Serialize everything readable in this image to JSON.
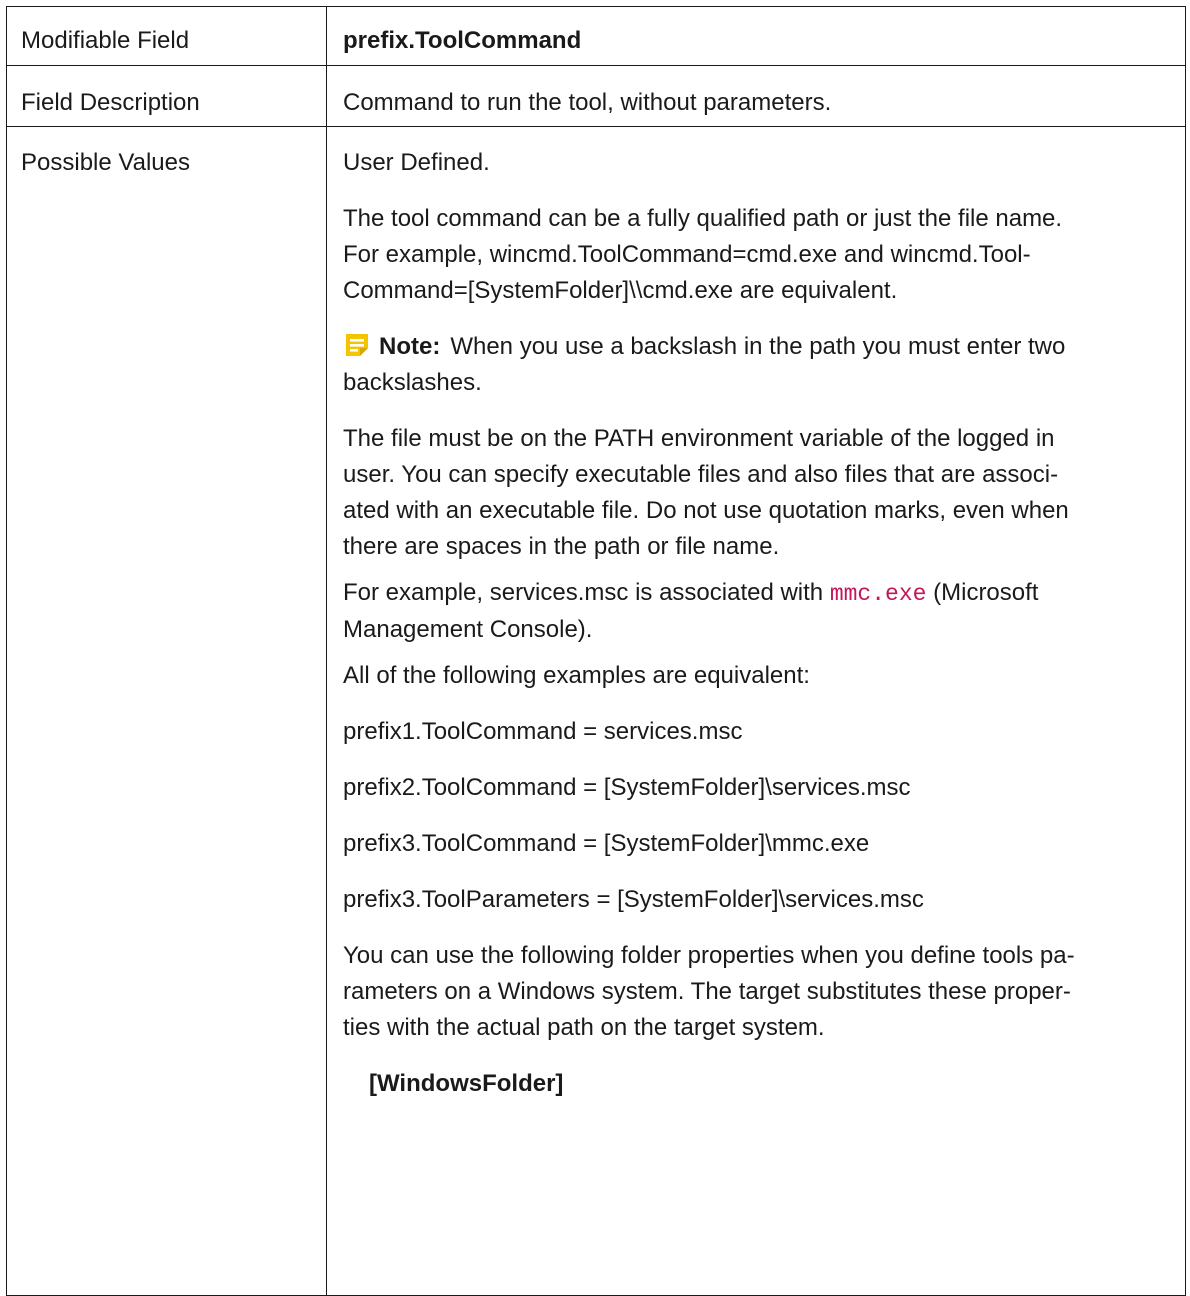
{
  "table": {
    "rows": {
      "modifiable_field": {
        "label": "Modifiable Field",
        "value": "prefix.ToolCommand"
      },
      "field_description": {
        "label": "Field Description",
        "value": "Command to run the tool, without parameters."
      },
      "possible_values": {
        "label": "Possible Values",
        "p1": "User Defined.",
        "p2_line1": "The tool command can be a fully qualified path or just the file name.",
        "p2_line2": "For example, wincmd.ToolCommand=cmd.exe and wincmd.Tool-",
        "p2_line3": "Command=[SystemFolder]\\\\cmd.exe are equivalent.",
        "note_label": "Note:",
        "note_text_line1": "When you use a backslash in the path you must enter two",
        "note_text_line2": "backslashes.",
        "p3_line1": "The file must be on the PATH environment variable of the logged in",
        "p3_line2": "user. You can specify executable files and also files that are associ-",
        "p3_line3": "ated with an executable file. Do not use quotation marks, even when",
        "p3_line4": "there are spaces in the path or file name.",
        "p4_before": "For example, services.msc is associated with ",
        "p4_code": "mmc.exe",
        "p4_after": " (Microsoft",
        "p4_line2": "Management Console).",
        "p5": "All of the following examples are equivalent:",
        "example1": "prefix1.ToolCommand = services.msc",
        "example2": "prefix2.ToolCommand = [SystemFolder]\\services.msc",
        "example3": "prefix3.ToolCommand = [SystemFolder]\\mmc.exe",
        "example4": "prefix3.ToolParameters = [SystemFolder]\\services.msc",
        "p6_line1": "You can use the following folder properties when you define tools pa-",
        "p6_line2": "rameters on a Windows system. The target substitutes these proper-",
        "p6_line3": "ties with the actual path on the target system.",
        "folder_heading": "[WindowsFolder]"
      }
    }
  },
  "colors": {
    "border": "#1a1a1a",
    "code_text": "#c2185b",
    "note_icon": "#f5c400"
  },
  "icons": {
    "note": "note-icon"
  }
}
